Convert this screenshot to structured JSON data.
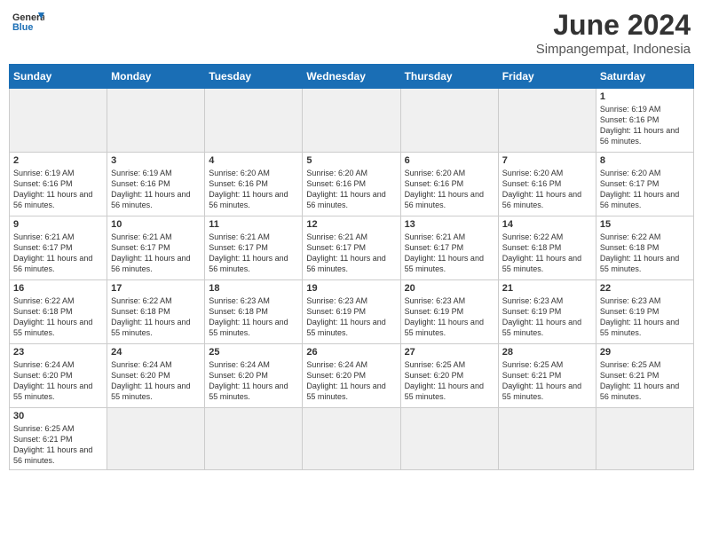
{
  "header": {
    "logo_general": "General",
    "logo_blue": "Blue",
    "month": "June 2024",
    "location": "Simpangempat, Indonesia"
  },
  "days_of_week": [
    "Sunday",
    "Monday",
    "Tuesday",
    "Wednesday",
    "Thursday",
    "Friday",
    "Saturday"
  ],
  "weeks": [
    [
      {
        "day": "",
        "empty": true
      },
      {
        "day": "",
        "empty": true
      },
      {
        "day": "",
        "empty": true
      },
      {
        "day": "",
        "empty": true
      },
      {
        "day": "",
        "empty": true
      },
      {
        "day": "",
        "empty": true
      },
      {
        "day": "1",
        "sunrise": "6:19 AM",
        "sunset": "6:16 PM",
        "daylight": "11 hours and 56 minutes."
      }
    ],
    [
      {
        "day": "2",
        "sunrise": "6:19 AM",
        "sunset": "6:16 PM",
        "daylight": "11 hours and 56 minutes."
      },
      {
        "day": "3",
        "sunrise": "6:19 AM",
        "sunset": "6:16 PM",
        "daylight": "11 hours and 56 minutes."
      },
      {
        "day": "4",
        "sunrise": "6:20 AM",
        "sunset": "6:16 PM",
        "daylight": "11 hours and 56 minutes."
      },
      {
        "day": "5",
        "sunrise": "6:20 AM",
        "sunset": "6:16 PM",
        "daylight": "11 hours and 56 minutes."
      },
      {
        "day": "6",
        "sunrise": "6:20 AM",
        "sunset": "6:16 PM",
        "daylight": "11 hours and 56 minutes."
      },
      {
        "day": "7",
        "sunrise": "6:20 AM",
        "sunset": "6:16 PM",
        "daylight": "11 hours and 56 minutes."
      },
      {
        "day": "8",
        "sunrise": "6:20 AM",
        "sunset": "6:17 PM",
        "daylight": "11 hours and 56 minutes."
      }
    ],
    [
      {
        "day": "9",
        "sunrise": "6:21 AM",
        "sunset": "6:17 PM",
        "daylight": "11 hours and 56 minutes."
      },
      {
        "day": "10",
        "sunrise": "6:21 AM",
        "sunset": "6:17 PM",
        "daylight": "11 hours and 56 minutes."
      },
      {
        "day": "11",
        "sunrise": "6:21 AM",
        "sunset": "6:17 PM",
        "daylight": "11 hours and 56 minutes."
      },
      {
        "day": "12",
        "sunrise": "6:21 AM",
        "sunset": "6:17 PM",
        "daylight": "11 hours and 56 minutes."
      },
      {
        "day": "13",
        "sunrise": "6:21 AM",
        "sunset": "6:17 PM",
        "daylight": "11 hours and 55 minutes."
      },
      {
        "day": "14",
        "sunrise": "6:22 AM",
        "sunset": "6:18 PM",
        "daylight": "11 hours and 55 minutes."
      },
      {
        "day": "15",
        "sunrise": "6:22 AM",
        "sunset": "6:18 PM",
        "daylight": "11 hours and 55 minutes."
      }
    ],
    [
      {
        "day": "16",
        "sunrise": "6:22 AM",
        "sunset": "6:18 PM",
        "daylight": "11 hours and 55 minutes."
      },
      {
        "day": "17",
        "sunrise": "6:22 AM",
        "sunset": "6:18 PM",
        "daylight": "11 hours and 55 minutes."
      },
      {
        "day": "18",
        "sunrise": "6:23 AM",
        "sunset": "6:18 PM",
        "daylight": "11 hours and 55 minutes."
      },
      {
        "day": "19",
        "sunrise": "6:23 AM",
        "sunset": "6:19 PM",
        "daylight": "11 hours and 55 minutes."
      },
      {
        "day": "20",
        "sunrise": "6:23 AM",
        "sunset": "6:19 PM",
        "daylight": "11 hours and 55 minutes."
      },
      {
        "day": "21",
        "sunrise": "6:23 AM",
        "sunset": "6:19 PM",
        "daylight": "11 hours and 55 minutes."
      },
      {
        "day": "22",
        "sunrise": "6:23 AM",
        "sunset": "6:19 PM",
        "daylight": "11 hours and 55 minutes."
      }
    ],
    [
      {
        "day": "23",
        "sunrise": "6:24 AM",
        "sunset": "6:20 PM",
        "daylight": "11 hours and 55 minutes."
      },
      {
        "day": "24",
        "sunrise": "6:24 AM",
        "sunset": "6:20 PM",
        "daylight": "11 hours and 55 minutes."
      },
      {
        "day": "25",
        "sunrise": "6:24 AM",
        "sunset": "6:20 PM",
        "daylight": "11 hours and 55 minutes."
      },
      {
        "day": "26",
        "sunrise": "6:24 AM",
        "sunset": "6:20 PM",
        "daylight": "11 hours and 55 minutes."
      },
      {
        "day": "27",
        "sunrise": "6:25 AM",
        "sunset": "6:20 PM",
        "daylight": "11 hours and 55 minutes."
      },
      {
        "day": "28",
        "sunrise": "6:25 AM",
        "sunset": "6:21 PM",
        "daylight": "11 hours and 55 minutes."
      },
      {
        "day": "29",
        "sunrise": "6:25 AM",
        "sunset": "6:21 PM",
        "daylight": "11 hours and 56 minutes."
      }
    ],
    [
      {
        "day": "30",
        "sunrise": "6:25 AM",
        "sunset": "6:21 PM",
        "daylight": "11 hours and 56 minutes."
      },
      {
        "day": "",
        "empty": true
      },
      {
        "day": "",
        "empty": true
      },
      {
        "day": "",
        "empty": true
      },
      {
        "day": "",
        "empty": true
      },
      {
        "day": "",
        "empty": true
      },
      {
        "day": "",
        "empty": true
      }
    ]
  ],
  "labels": {
    "sunrise": "Sunrise:",
    "sunset": "Sunset:",
    "daylight": "Daylight:"
  }
}
